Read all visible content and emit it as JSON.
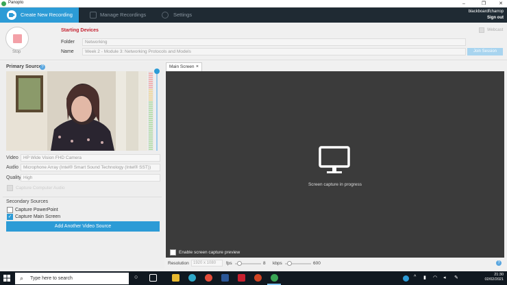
{
  "window": {
    "title": "Panopto"
  },
  "nav": {
    "create_label": "Create New Recording",
    "manage_label": "Manage Recordings",
    "settings_label": "Settings",
    "username": "blackboardfcharrop",
    "sign_out": "Sign out"
  },
  "recording": {
    "stop_label": "Stop",
    "status": "Starting Devices",
    "folder_label": "Folder",
    "folder_value": "Networking",
    "name_label": "Name",
    "name_value": "Week 2 - Module 3: Networking Protocols and Models",
    "webcast_label": "Webcast",
    "join_label": "Join Session"
  },
  "primary": {
    "title": "Primary Sources",
    "video_label": "Video",
    "video_value": "HP Wide Vision FHD Camera",
    "audio_label": "Audio",
    "audio_value": "Microphone Array (Intel® Smart Sound Technology (Intel® SST))",
    "quality_label": "Quality",
    "quality_value": "High",
    "capture_audio_label": "Capture Computer Audio"
  },
  "secondary": {
    "title": "Secondary Sources",
    "ppt_label": "Capture PowerPoint",
    "ppt_checked": false,
    "screen_label": "Capture Main Screen",
    "screen_checked": true,
    "add_label": "Add Another Video Source"
  },
  "screen": {
    "tab_label": "Main Screen",
    "capture_text": "Screen capture in progress",
    "preview_label": "Enable screen capture preview",
    "resolution_label": "Resolution",
    "resolution_value": "1920 x 1080",
    "fps_label": "fps",
    "fps_value": "8",
    "kbps_label": "kbps",
    "kbps_value": "600"
  },
  "taskbar": {
    "search_placeholder": "Type here to search",
    "time": "21:30",
    "date": "02/02/2021"
  },
  "colors": {
    "accent": "#2c9bd6",
    "nav_bg": "#1f2a33",
    "status_red": "#c4202e"
  }
}
